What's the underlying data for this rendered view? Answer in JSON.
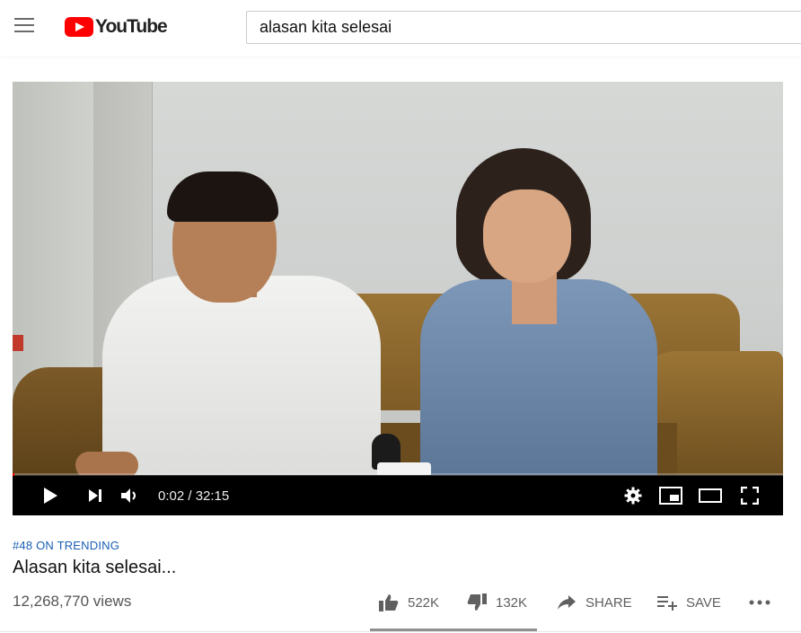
{
  "header": {
    "logo_text": "YouTube",
    "search_query": "alasan kita selesai"
  },
  "player": {
    "current_time": "0:02",
    "duration": "32:15",
    "time_display": "0:02 / 32:15",
    "progress_fraction": 0.001,
    "accent_color": "#ff0000"
  },
  "video_info": {
    "trending_label": "#48 ON TRENDING",
    "title": "Alasan kita selesai...",
    "views": "12,268,770 views",
    "likes": "522K",
    "dislikes": "132K",
    "share_label": "SHARE",
    "save_label": "SAVE",
    "like_ratio": 0.798
  },
  "icons": {
    "menu": "hamburger-icon",
    "play": "play-icon",
    "next": "next-icon",
    "volume": "volume-icon",
    "settings": "gear-icon",
    "miniplayer": "miniplayer-icon",
    "theater": "theater-icon",
    "fullscreen": "fullscreen-icon",
    "like": "thumbs-up-icon",
    "dislike": "thumbs-down-icon",
    "share": "share-icon",
    "save": "playlist-add-icon",
    "more": "more-icon"
  }
}
